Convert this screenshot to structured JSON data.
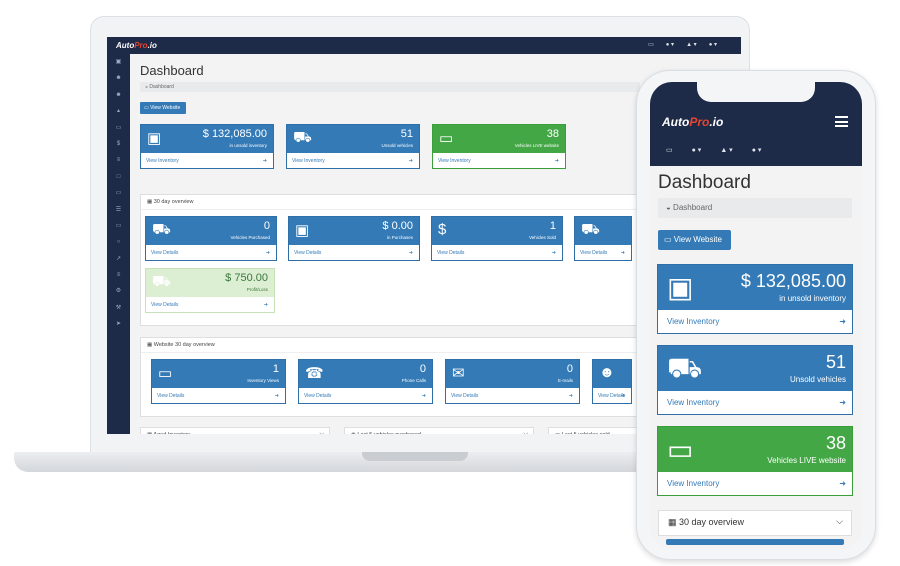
{
  "brand": {
    "name_prefix": "Auto",
    "name_accent": "Pro",
    "name_suffix": ".io",
    "accent_color": "#e6452f",
    "nav_bg": "#1d2a48"
  },
  "colors": {
    "primary": "#337ab7",
    "success": "#43a745",
    "pale_success": "#dcefd2"
  },
  "laptop": {
    "top_icons": [
      "▭",
      "● ▾",
      "▲ ▾",
      "● ▾"
    ],
    "sidebar_icons": [
      "▣",
      "☻",
      "☻",
      "▴",
      "▭",
      "$",
      "≡",
      "□",
      "▭",
      "☰",
      "▭",
      "○",
      "↗",
      "≡",
      "⚙",
      "⚒",
      "➤"
    ],
    "title": "Dashboard",
    "breadcrumb": "◒ Dashboard",
    "view_website": "▭ View Website",
    "stats": [
      {
        "icon": "money-icon",
        "glyph": "▣",
        "value": "$ 132,085.00",
        "label": "in unsold inventory",
        "link": "View Inventory",
        "color": "blue"
      },
      {
        "icon": "car-icon",
        "glyph": "⛟",
        "value": "51",
        "label": "Unsold vehicles",
        "link": "View Inventory",
        "color": "blue"
      },
      {
        "icon": "monitor-icon",
        "glyph": "▭",
        "value": "38",
        "label": "Vehicles LIVE website",
        "link": "View Inventory",
        "color": "green"
      }
    ],
    "overview_title": "▦ 30 day overview",
    "overview": [
      {
        "icon": "car-icon",
        "glyph": "⛟",
        "value": "0",
        "label": "Vehicles Purchased",
        "link": "View Details",
        "color": "blue"
      },
      {
        "icon": "money-icon",
        "glyph": "▣",
        "value": "$ 0.00",
        "label": "in Purchases",
        "link": "View Details",
        "color": "blue"
      },
      {
        "icon": "dollar-icon",
        "glyph": "$",
        "value": "1",
        "label": "Vehicles Sold",
        "link": "View Details",
        "color": "blue"
      },
      {
        "icon": "car-icon",
        "glyph": "⛟",
        "value": "",
        "label": "",
        "link": "View Details",
        "color": "blue"
      },
      {
        "icon": "car-icon",
        "glyph": "⛟",
        "value": "$ 750.00",
        "label": "Profit/Loss",
        "link": "View Details",
        "color": "pale"
      }
    ],
    "website_title": "▦ Website 30 day overview",
    "website": [
      {
        "icon": "monitor-icon",
        "glyph": "▭",
        "value": "1",
        "label": "Inventory Views",
        "link": "View Details"
      },
      {
        "icon": "phone-icon",
        "glyph": "☎",
        "value": "0",
        "label": "Phone Calls",
        "link": "View Details"
      },
      {
        "icon": "envelope-icon",
        "glyph": "✉",
        "value": "0",
        "label": "E-mails",
        "link": "View Details"
      },
      {
        "icon": "users-icon",
        "glyph": "☻",
        "value": "",
        "label": "",
        "link": "View Details"
      }
    ],
    "bottom_panels": [
      "▦ Aged Inventory",
      "◉ Last 5 vehicles purchased",
      "▭ Last 5 vehicles sold"
    ]
  },
  "mobile": {
    "icons": [
      "▭",
      "● ▾",
      "▲ ▾",
      "● ▾"
    ],
    "title": "Dashboard",
    "breadcrumb": "◒ Dashboard",
    "view_website": "▭ View Website",
    "stats": [
      {
        "icon": "money-icon",
        "glyph": "▣",
        "value": "$ 132,085.00",
        "label": "in unsold inventory",
        "link": "View Inventory",
        "color": "blue"
      },
      {
        "icon": "car-icon",
        "glyph": "⛟",
        "value": "51",
        "label": "Unsold vehicles",
        "link": "View Inventory",
        "color": "blue"
      },
      {
        "icon": "monitor-icon",
        "glyph": "▭",
        "value": "38",
        "label": "Vehicles LIVE website",
        "link": "View Inventory",
        "color": "green"
      }
    ],
    "panel": "▦ 30 day overview",
    "arrow": "➜",
    "chevron": "⌵"
  }
}
